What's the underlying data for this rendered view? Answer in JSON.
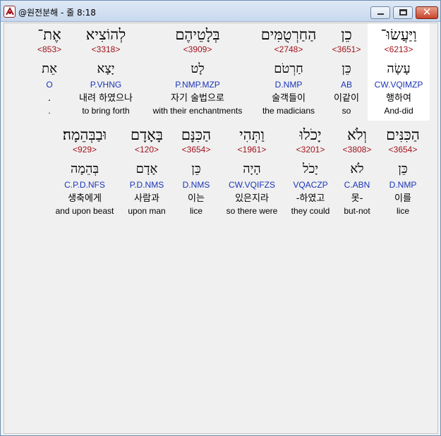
{
  "window": {
    "title": "@원전분해 - 줄 8:18",
    "close_glyph": "✕"
  },
  "verse": {
    "line1": [
      {
        "hebrew": "אֶת־",
        "strong": "<853>",
        "lexeme": "אֵת",
        "morph": "O",
        "korean": ".",
        "english": "."
      },
      {
        "hebrew": "לְהוֹצִיא",
        "strong": "<3318>",
        "lexeme": "יָצָא",
        "morph": "P.VHNG",
        "korean": "내려 하였으나",
        "english": "to bring forth"
      },
      {
        "hebrew": "בְּלָטֵיהֶם",
        "strong": "<3909>",
        "lexeme": "לָט",
        "morph": "P.NMP.MZP",
        "korean": "자기 술법으로",
        "english": "with their enchantments"
      },
      {
        "hebrew": "הַחַרְטֻמִּים",
        "strong": "<2748>",
        "lexeme": "חַרְטֹם",
        "morph": "D.NMP",
        "korean": "술객들이",
        "english": "the madicians"
      },
      {
        "hebrew": "כֵן",
        "strong": "<3651>",
        "lexeme": "כֵּן",
        "morph": "AB",
        "korean": "이같이",
        "english": "so"
      },
      {
        "hebrew": "וַיַּעֲשׂוּ־",
        "strong": "<6213>",
        "lexeme": "עָשָׂה",
        "morph": "CW.VQIMZP",
        "korean": "행하여",
        "english": "And-did"
      }
    ],
    "line2": [
      {
        "hebrew": "וּבַבְּהֵמָה׃",
        "strong": "<929>",
        "lexeme": "בְּהֵמָה",
        "morph": "C.P.D.NFS",
        "korean": "생축에게",
        "english": "and upon beast"
      },
      {
        "hebrew": "בָּאָדָם",
        "strong": "<120>",
        "lexeme": "אָדָם",
        "morph": "P.D.NMS",
        "korean": "사람과",
        "english": "upon man"
      },
      {
        "hebrew": "הַכִּנָּם",
        "strong": "<3654>",
        "lexeme": "כֵּן",
        "morph": "D.NMS",
        "korean": "이는",
        "english": "lice"
      },
      {
        "hebrew": "וַתְּהִי",
        "strong": "<1961>",
        "lexeme": "הָיָה",
        "morph": "CW.VQIFZS",
        "korean": "있은지라",
        "english": "so there were"
      },
      {
        "hebrew": "יָכֹלוּ",
        "strong": "<3201>",
        "lexeme": "יָכֹל",
        "morph": "VQACZP",
        "korean": "-하였고",
        "english": "they could"
      },
      {
        "hebrew": "וְלֹא",
        "strong": "<3808>",
        "lexeme": "לֹא",
        "morph": "C.ABN",
        "korean": "못-",
        "english": "but-not"
      },
      {
        "hebrew": "הַכִּנִּים",
        "strong": "<3654>",
        "lexeme": "כֵּן",
        "morph": "D.NMP",
        "korean": "이를",
        "english": "lice"
      }
    ]
  }
}
